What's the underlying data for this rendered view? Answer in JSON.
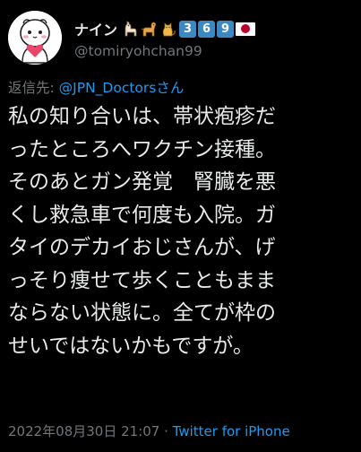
{
  "author": {
    "display_name": "ナイン",
    "name_icons": [
      "llama-emoji",
      "dog-emoji",
      "cat-emoji",
      "keycap-3",
      "keycap-6",
      "keycap-9",
      "japan-flag-emoji"
    ],
    "keycaps": [
      "3",
      "6",
      "9"
    ],
    "handle": "@tomiryohchan99"
  },
  "reply": {
    "prefix": "返信先: ",
    "mention": "@JPN_Doctorsさん"
  },
  "tweet": {
    "lines": [
      "私の知り合いは、帯状疱疹だ",
      "ったところへワクチン接種。",
      "そのあとガン発覚　腎臓を悪",
      "くし救急車で何度も入院。ガ",
      "タイのデカイおじさんが、げ",
      "っそり痩せて歩くこともまま",
      "ならない状態に。全てが枠の",
      "せいではないかもですが。"
    ]
  },
  "meta": {
    "timestamp": "2022年08月30日 21:07",
    "separator": " · ",
    "source": "Twitter for iPhone"
  },
  "colors": {
    "background": "#000000",
    "text": "#e7e9ea",
    "secondary": "#71767b",
    "link": "#1d9bf0"
  }
}
